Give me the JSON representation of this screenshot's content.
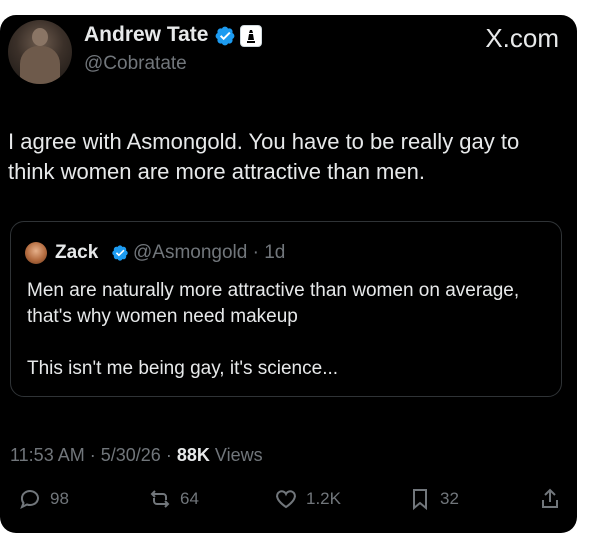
{
  "author": {
    "name": "Andrew Tate",
    "handle": "@Cobratate"
  },
  "brand": {
    "logo_text": "X.com"
  },
  "tweet": {
    "text": "I agree with Asmongold. You have to be really gay to think women are more attractive than men."
  },
  "quote": {
    "name": "Zack",
    "handle": "@Asmongold",
    "separator": "·",
    "age": "1d",
    "lines": [
      "Men are naturally more attractive than women on average, that's why women need makeup",
      "This isn't me being gay, it's science..."
    ]
  },
  "meta": {
    "time": "11:53 AM",
    "date": "5/30/26",
    "views_count": "88K",
    "views_label": "Views",
    "separator": "·"
  },
  "actions": {
    "replies": "98",
    "reposts": "64",
    "likes": "1.2K",
    "bookmarks": "32"
  },
  "colors": {
    "background": "#000000",
    "text": "#e7e9ea",
    "muted": "#71767b",
    "verified": "#1d9bf0",
    "border": "#2f3336"
  },
  "icons": [
    "verified-icon",
    "affiliate-badge-icon",
    "reply-icon",
    "repost-icon",
    "like-icon",
    "bookmark-icon",
    "share-icon"
  ]
}
